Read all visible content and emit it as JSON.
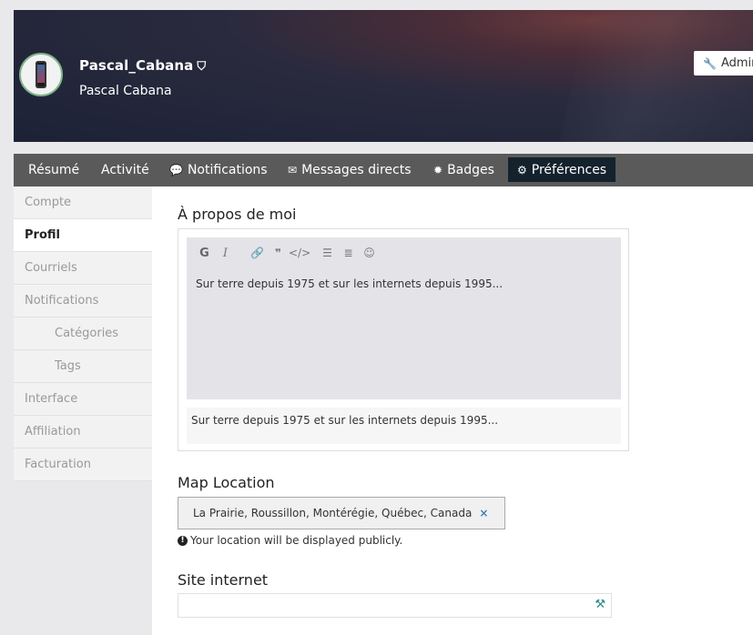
{
  "header": {
    "username": "Pascal_Cabana",
    "full_name": "Pascal Cabana",
    "admin_label": "Admin",
    "icons": {
      "avatar": "avatar-phone",
      "shield": "shield-icon",
      "wrench": "wrench-icon"
    }
  },
  "nav": {
    "items": [
      {
        "label": "Résumé"
      },
      {
        "label": "Activité"
      },
      {
        "label": "Notifications",
        "icon": "comment-icon"
      },
      {
        "label": "Messages directs",
        "icon": "envelope-icon"
      },
      {
        "label": "Badges",
        "icon": "certificate-icon"
      },
      {
        "label": "Préférences",
        "icon": "gear-icon",
        "active": true
      }
    ]
  },
  "sidebar": {
    "items": [
      {
        "label": "Compte"
      },
      {
        "label": "Profil",
        "active": true
      },
      {
        "label": "Courriels"
      },
      {
        "label": "Notifications"
      },
      {
        "label": "Catégories",
        "sub": true
      },
      {
        "label": "Tags",
        "sub": true
      },
      {
        "label": "Interface"
      },
      {
        "label": "Affiliation"
      },
      {
        "label": "Facturation"
      }
    ]
  },
  "main": {
    "about_title": "À propos de moi",
    "editor_text": "Sur terre depuis 1975 et sur les internets depuis 1995...",
    "preview_text": "Sur terre depuis 1975 et sur les internets depuis 1995...",
    "toolbar": {
      "bold": "G",
      "italic": "I"
    },
    "map_title": "Map Location",
    "location_value": "La Prairie, Roussillon, Montérégie, Québec, Canada",
    "location_remove": "×",
    "location_hint": "Your location will be displayed publicly.",
    "site_title": "Site internet",
    "site_value": ""
  },
  "colors": {
    "nav_bg": "#5a5a5a",
    "nav_active": "#14222e",
    "link_blue": "#3a7fc0"
  }
}
